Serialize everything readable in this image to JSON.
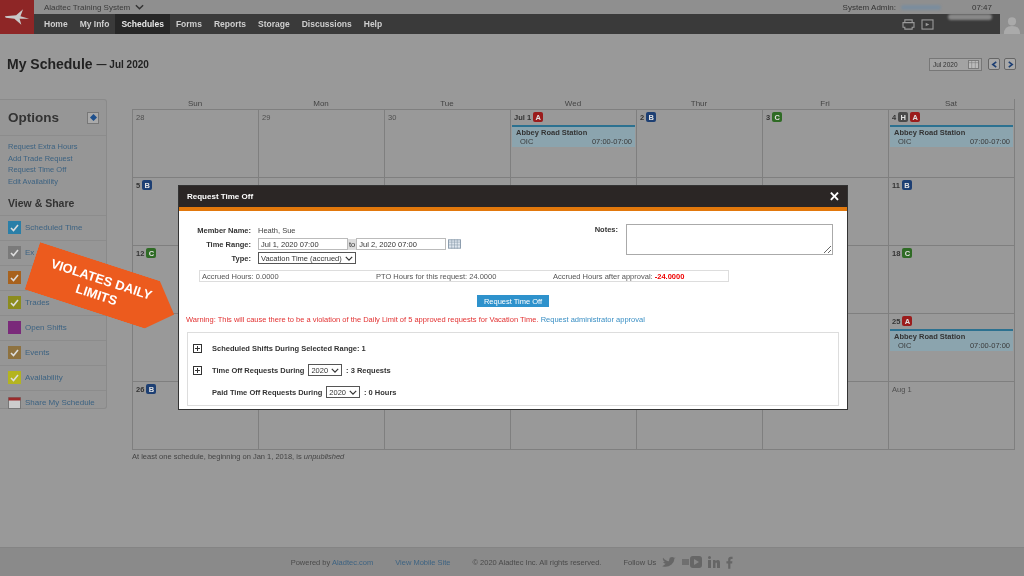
{
  "app": {
    "name": "Aladtec Training System",
    "user_label": "System Admin:",
    "time": "07:47"
  },
  "nav": [
    {
      "label": "Home",
      "selected": false
    },
    {
      "label": "My Info",
      "selected": false
    },
    {
      "label": "Schedules",
      "selected": true
    },
    {
      "label": "Forms",
      "selected": false
    },
    {
      "label": "Reports",
      "selected": false
    },
    {
      "label": "Storage",
      "selected": false
    },
    {
      "label": "Discussions",
      "selected": false
    },
    {
      "label": "Help",
      "selected": false
    }
  ],
  "page": {
    "title": "My Schedule",
    "subtitle": "— Jul 2020",
    "month_field": "Jul 2020"
  },
  "sidebar": {
    "title": "Options",
    "links": [
      "Request Extra Hours",
      "Add Trade Request",
      "Request Time Off",
      "Edit Availability"
    ],
    "section": "View & Share",
    "items": [
      {
        "kind": "checkbox",
        "label": "Scheduled Time",
        "checked": true,
        "color": "#2a7fa8"
      },
      {
        "kind": "checkbox",
        "label": "Ex",
        "checked": true,
        "color": "#7a7a7a"
      },
      {
        "kind": "checkbox",
        "checked": true,
        "color": "#a8621e"
      },
      {
        "kind": "checkbox",
        "label": "Trades",
        "checked": true,
        "color": "#8c8c1e"
      },
      {
        "kind": "checkbox",
        "label": "Open Shifts",
        "checked": false,
        "color": "#7a2a7a"
      },
      {
        "kind": "checkbox",
        "label": "Events",
        "checked": true,
        "color": "#8e7240"
      },
      {
        "kind": "checkbox",
        "label": "Availability",
        "checked": true,
        "color": "#b4b420"
      },
      {
        "kind": "calendar",
        "label": "Share My Schedule"
      }
    ]
  },
  "calendar": {
    "weekdays": [
      "Sun",
      "Mon",
      "Tue",
      "Wed",
      "Thur",
      "Fri",
      "Sat"
    ],
    "weeks": [
      {
        "days": [
          {
            "day": "28",
            "muted": true
          },
          {
            "day": "29",
            "muted": true
          },
          {
            "day": "30",
            "muted": true
          },
          {
            "day": "Jul 1",
            "muted": false,
            "badges": [
              {
                "letter": "A",
                "color": "#9b1c1c"
              }
            ],
            "shifts": [
              {
                "station": "Abbey Road Station",
                "role": "OIC",
                "time": "07:00-07:00"
              }
            ]
          },
          {
            "day": "2",
            "muted": false,
            "badges": [
              {
                "letter": "B",
                "color": "#1d3f73"
              }
            ]
          },
          {
            "day": "3",
            "muted": false,
            "badges": [
              {
                "letter": "C",
                "color": "#2f6b25"
              }
            ]
          },
          {
            "day": "4",
            "muted": false,
            "badges": [
              {
                "letter": "H",
                "color": "#4a4a4a"
              },
              {
                "letter": "A",
                "color": "#9b1c1c"
              }
            ],
            "shifts": [
              {
                "station": "Abbey Road Station",
                "role": "OIC",
                "time": "07:00-07:00"
              }
            ]
          }
        ]
      },
      {
        "sun": {
          "day": "5",
          "muted": false,
          "badges": [
            {
              "letter": "B",
              "color": "#1d3f73"
            }
          ]
        },
        "sat": {
          "day": "11",
          "muted": false,
          "badges": [
            {
              "letter": "B",
              "color": "#1d3f73"
            }
          ]
        }
      },
      {
        "sun": {
          "day": "12",
          "muted": false,
          "badges": [
            {
              "letter": "C",
              "color": "#2f6b25"
            }
          ]
        },
        "sat": {
          "day": "18",
          "muted": false,
          "badges": [
            {
              "letter": "C",
              "color": "#2f6b25"
            }
          ]
        }
      },
      {
        "sat": {
          "day": "25",
          "muted": false,
          "badges": [
            {
              "letter": "A",
              "color": "#9b1c1c"
            }
          ],
          "shifts": [
            {
              "station": "Abbey Road Station",
              "role": "OIC",
              "time": "07:00-07:00"
            }
          ]
        }
      },
      {
        "sun": {
          "day": "26",
          "muted": false,
          "badges": [
            {
              "letter": "B",
              "color": "#1d3f73"
            }
          ]
        },
        "sat": {
          "day": "Aug 1",
          "muted": true
        }
      }
    ],
    "note": "At least one schedule, beginning on Jan 1, 2018, is *unpublished*"
  },
  "modal": {
    "title": "Request Time Off",
    "close": "✕",
    "member_label": "Member Name:",
    "member": "Heath, Sue",
    "range_label": "Time Range:",
    "range_start": "Jul 1, 2020 07:00",
    "range_to": "to",
    "range_end": "Jul 2, 2020 07:00",
    "type_label": "Type:",
    "type": "Vacation Time (accrued)",
    "notes_label": "Notes:",
    "accrued": "Accrued Hours: 0.0000",
    "pto": "PTO Hours for this request: 24.0000",
    "after_label": "Accrued Hours after approval:",
    "after_value": "-24.0000",
    "submit": "Request Time Off",
    "warning": "Warning: This will cause there to be a violation of the Daily Limit of 5 approved requests for Vacation Time.",
    "approval_link": "Request administrator approval",
    "sections": [
      {
        "kind": "expander",
        "label": "Scheduled Shifts During Selected Range: 1"
      },
      {
        "kind": "expander",
        "label": "Time Off Requests During",
        "year": "2020",
        "suffix": ": 3 Requests"
      },
      {
        "kind": "plain",
        "label": "Paid Time Off Requests During",
        "year": "2020",
        "suffix": ": 0 Hours"
      }
    ]
  },
  "callout": "VIOLATES DAILY LIMITS",
  "footer": {
    "powered": "Powered by",
    "powered_link": "Aladtec.com",
    "mobile": "View Mobile Site",
    "copyright": "© 2020 Aladtec Inc. All rights reserved.",
    "follow": "Follow Us"
  }
}
